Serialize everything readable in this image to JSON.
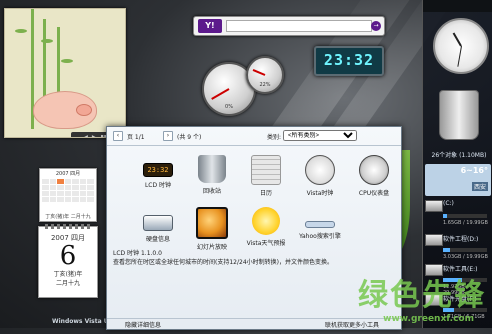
{
  "photo": {
    "controls": [
      "◀",
      "▶",
      "▮▮",
      "■"
    ]
  },
  "calendar_small": {
    "header": "2007 四月",
    "footer": "丁亥(猪)年 二月十九"
  },
  "calendar_big": {
    "month": "2007 四月",
    "day": "6",
    "weekday": "丁亥(猪)年",
    "lunar": "二月十九"
  },
  "taskbar_text": "Windows Vista Ultimate",
  "yahoo": {
    "logo": "Y!",
    "go": "→",
    "query": ""
  },
  "gauges": {
    "cpu": "0%",
    "mem": "22%",
    "cpu_value": 0,
    "mem_value": 22
  },
  "lcd_clock": "23:32",
  "sidebar": {
    "recycle_bin": "26个对象 (1.10MB)",
    "weather": {
      "temp": "6~16°",
      "city": "西安"
    },
    "drives": [
      {
        "label": "(C:)",
        "size": "1.65GB / 19.99GB",
        "used_fraction": 0.08
      },
      {
        "label": "软件工程(D:)",
        "size": "3.03GB / 19.99GB",
        "used_fraction": 0.15
      },
      {
        "label": "软件工具(E:)",
        "size": "12.97GB / 29.99GB",
        "used_fraction": 0.43
      },
      {
        "label": "软件光盘(F:)",
        "size": "1.71GB / 6.71GB",
        "used_fraction": 0.25
      }
    ]
  },
  "gallery": {
    "page": "页 1/1",
    "count": "(共 9 个)",
    "category_label": "类别:",
    "category_value": "<所有类别>",
    "items": [
      {
        "caption": "LCD 时钟",
        "icon": "lcd-clock-icon",
        "color": "#2b1e0b"
      },
      {
        "caption": "回收站",
        "icon": "recycle-bin-icon",
        "color": "#9aa4ad"
      },
      {
        "caption": "日历",
        "icon": "calendar-icon",
        "color": "#e7e7e7"
      },
      {
        "caption": "Vista时钟",
        "icon": "clock-icon",
        "color": "#efefef"
      },
      {
        "caption": "CPU仪表盘",
        "icon": "gauge-icon",
        "color": "#cfcfcf"
      },
      {
        "caption": "硬盘信息",
        "icon": "hard-drive-icon",
        "color": "#d6dde5"
      },
      {
        "caption": "幻灯片放映",
        "icon": "slideshow-icon",
        "color": "#e89220"
      },
      {
        "caption": "Vista天气预报",
        "icon": "weather-icon",
        "color": "#ffd22b"
      },
      {
        "caption": "Yahoo搜索引擎",
        "icon": "search-icon",
        "color": "#c7d7e9"
      }
    ],
    "detail_title": "LCD 时钟 1.1.0.0",
    "detail_text": "查看您所在时区或全球任何城市的时间(支持12/24小时制转换)，并文件颜色变换。",
    "footer_left": "隐藏详细信息",
    "footer_right": "联机获取更多小工具"
  },
  "watermark": {
    "text": "绿色先锋",
    "url": "www.greenxf.com"
  }
}
